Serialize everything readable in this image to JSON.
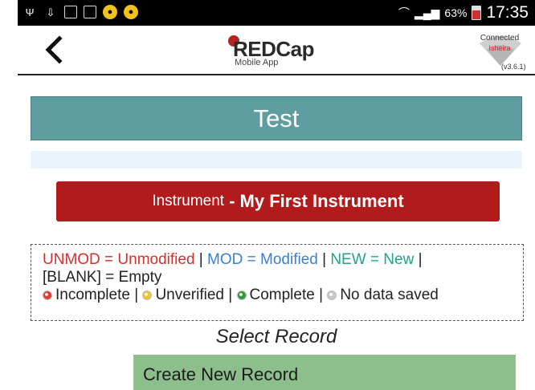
{
  "status_bar": {
    "signal_percent": "63%",
    "time": "17:35"
  },
  "app_bar": {
    "logo_main": "REDCap",
    "logo_sub": "Mobile App",
    "connection_label": "Connected",
    "connection_host": "Isheira",
    "version": "(v3.6.1)"
  },
  "project": {
    "title": "Test"
  },
  "instrument": {
    "prefix": "Instrument",
    "name": "- My First Instrument"
  },
  "legend": {
    "unmod": "UNMOD = Unmodified",
    "sep1": " | ",
    "mod": "MOD = Modified",
    "sep2": " | ",
    "new": "NEW = New",
    "sep3": " |",
    "blank": "[BLANK] = Empty",
    "status": [
      {
        "label": "Incomplete",
        "color": "red"
      },
      {
        "label": "Unverified",
        "color": "yellow"
      },
      {
        "label": "Complete",
        "color": "green"
      },
      {
        "label": "No data saved",
        "color": "gray"
      }
    ]
  },
  "records": {
    "select_label": "Select Record",
    "create_button": "Create New Record"
  },
  "colors": {
    "title_bar": "#5f9ea0",
    "instrument_button": "#b21b1b",
    "create_button": "#8cbf8c"
  }
}
